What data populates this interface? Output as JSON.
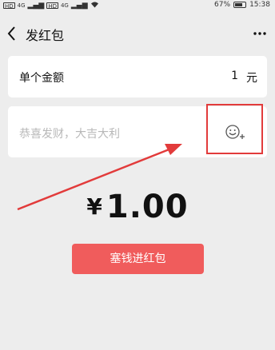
{
  "status_bar": {
    "left_chips": [
      "HD",
      "4G",
      "HD",
      "4G"
    ],
    "battery": "67%",
    "time": "15:38"
  },
  "nav": {
    "title": "发红包",
    "back_icon": "chevron-left-icon",
    "more_icon": "more-dots-icon"
  },
  "amount_row": {
    "label": "单个金额",
    "value": "1",
    "unit": "元"
  },
  "message": {
    "placeholder": "恭喜发财，大吉大利",
    "emoji_icon": "emoji-add-icon"
  },
  "total": {
    "currency": "¥",
    "amount": "1.00"
  },
  "submit_label": "塞钱进红包",
  "colors": {
    "background": "#ededed",
    "accent_button": "#f05c5c",
    "annotation": "#e23b3b",
    "placeholder": "#b8b8b8"
  }
}
